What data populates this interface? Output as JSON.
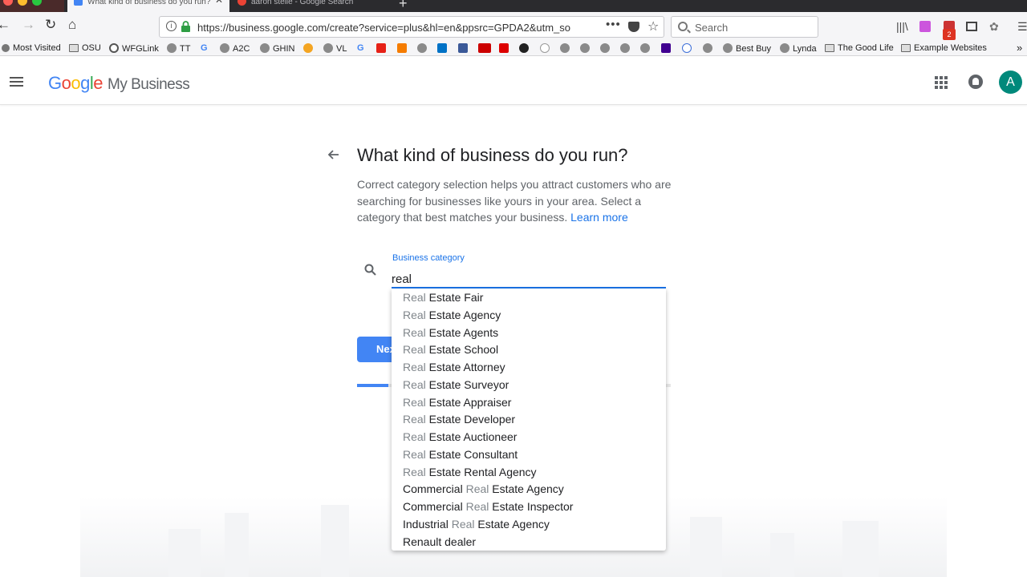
{
  "browser": {
    "tabs": [
      {
        "title": "What kind of business do you run?",
        "active": true
      },
      {
        "title": "aaron stelle - Google Search",
        "active": false
      }
    ],
    "url": "https://business.google.com/create?service=plus&hl=en&ppsrc=GPDA2&utm_so",
    "search_placeholder": "Search",
    "notification_badge": "2",
    "bookmarks": [
      "Most Visited",
      "OSU",
      "WFGLink",
      "TT",
      "A2C",
      "GHIN",
      "VL",
      "Best Buy",
      "Lynda",
      "The Good Life",
      "Example Websites"
    ]
  },
  "app": {
    "logo_letters": [
      "G",
      "o",
      "o",
      "g",
      "l",
      "e"
    ],
    "product": "My Business",
    "avatar_initial": "A"
  },
  "page": {
    "title": "What kind of business do you run?",
    "description": "Correct category selection helps you attract customers who are searching for businesses like yours in your area. Select a category that best matches your business.",
    "learn_more": "Learn more",
    "field_label": "Business category",
    "field_value": "real",
    "next_label": "Next",
    "progress_fraction": 0.1
  },
  "suggestions": [
    {
      "pre": "",
      "hl": "Real",
      "post": " Estate Fair"
    },
    {
      "pre": "",
      "hl": "Real",
      "post": " Estate Agency"
    },
    {
      "pre": "",
      "hl": "Real",
      "post": " Estate Agents"
    },
    {
      "pre": "",
      "hl": "Real",
      "post": " Estate School"
    },
    {
      "pre": "",
      "hl": "Real",
      "post": " Estate Attorney"
    },
    {
      "pre": "",
      "hl": "Real",
      "post": " Estate Surveyor"
    },
    {
      "pre": "",
      "hl": "Real",
      "post": " Estate Appraiser"
    },
    {
      "pre": "",
      "hl": "Real",
      "post": " Estate Developer"
    },
    {
      "pre": "",
      "hl": "Real",
      "post": " Estate Auctioneer"
    },
    {
      "pre": "",
      "hl": "Real",
      "post": " Estate Consultant"
    },
    {
      "pre": "",
      "hl": "Real",
      "post": " Estate Rental Agency"
    },
    {
      "pre": "Commercial ",
      "hl": "Real",
      "post": " Estate Agency"
    },
    {
      "pre": "Commercial ",
      "hl": "Real",
      "post": " Estate Inspector"
    },
    {
      "pre": "Industrial ",
      "hl": "Real",
      "post": " Estate Agency"
    },
    {
      "pre": "Renault dealer",
      "hl": "",
      "post": ""
    }
  ],
  "colors": {
    "accent": "#1a73e8",
    "button": "#4285f4",
    "avatar": "#00897b"
  }
}
